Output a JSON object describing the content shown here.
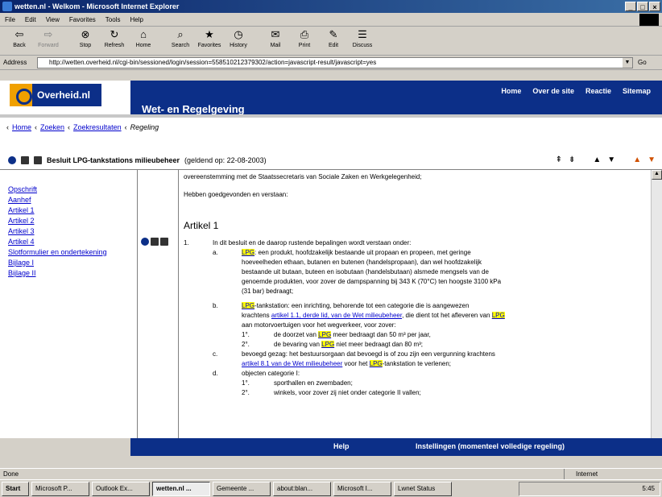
{
  "window": {
    "title": "wetten.nl - Welkom - Microsoft Internet Explorer",
    "buttons": [
      "_",
      "□",
      "×"
    ]
  },
  "menu": [
    "File",
    "Edit",
    "View",
    "Favorites",
    "Tools",
    "Help"
  ],
  "toolbar": [
    {
      "label": "Back",
      "icon": "back-icon",
      "glyph": "⇦",
      "disabled": false
    },
    {
      "label": "Forward",
      "icon": "forward-icon",
      "glyph": "⇨",
      "disabled": true
    },
    {
      "label": "Stop",
      "icon": "stop-icon",
      "glyph": "⊗",
      "disabled": false
    },
    {
      "label": "Refresh",
      "icon": "refresh-icon",
      "glyph": "↻",
      "disabled": false
    },
    {
      "label": "Home",
      "icon": "home-icon",
      "glyph": "⌂",
      "disabled": false
    },
    {
      "label": "Search",
      "icon": "search-icon",
      "glyph": "⌕",
      "disabled": false
    },
    {
      "label": "Favorites",
      "icon": "favorites-icon",
      "glyph": "★",
      "disabled": false
    },
    {
      "label": "History",
      "icon": "history-icon",
      "glyph": "◷",
      "disabled": false
    },
    {
      "label": "Mail",
      "icon": "mail-icon",
      "glyph": "✉",
      "disabled": false
    },
    {
      "label": "Print",
      "icon": "print-icon",
      "glyph": "⎙",
      "disabled": false
    },
    {
      "label": "Edit",
      "icon": "edit-icon",
      "glyph": "✎",
      "disabled": false
    },
    {
      "label": "Discuss",
      "icon": "discuss-icon",
      "glyph": "☰",
      "disabled": false
    }
  ],
  "address": {
    "label": "Address",
    "url": "http://wetten.overheid.nl/cgi-bin/sessioned/login/session=558510212379302/action=javascript-result/javascript=yes",
    "go": "Go"
  },
  "site": {
    "logo_text": "Overheid.nl",
    "section_title": "Wet- en Regelgeving",
    "topnav": [
      "Home",
      "Over de site",
      "Reactie",
      "Sitemap"
    ]
  },
  "breadcrumb": {
    "items": [
      "Home",
      "Zoeken",
      "Zoekresultaten"
    ],
    "current": "Regeling"
  },
  "docbar": {
    "title": "Besluit LPG-tankstations milieubeheer",
    "validity": "(geldend op: 22-08-2003)"
  },
  "leftnav": [
    "Opschrift",
    "Aanhef",
    "Artikel 1",
    "Artikel 2",
    "Artikel 3",
    "Artikel 4",
    "Slotformulier en ondertekening",
    "Bijlage I",
    "Bijlage II"
  ],
  "document": {
    "intro1": "overeenstemming met de Staatssecretaris van Sociale Zaken en Werkgelegenheid;",
    "intro2": "Hebben goedgevonden en verstaan:",
    "article_title": "Artikel 1",
    "para_num": "1.",
    "para_text": "In dit besluit en de daarop rustende bepalingen wordt verstaan onder:",
    "a_label": "a.",
    "a_lpg": "LPG",
    "a_text1": ": een produkt, hoofdzakelijk bestaande uit propaan en propeen, met geringe",
    "a_text2": "hoeveelheden ethaan, butanen en butenen (handelspropaan), dan wel hoofdzakelijk",
    "a_text3": "bestaande uit butaan, buteen en isobutaan (handelsbutaan) alsmede mengsels van de",
    "a_text4": "genoemde produkten, voor zover de dampspanning bij 343 K (70°C) ten hoogste 3100 kPa",
    "a_text5": "(31 bar) bedraagt;",
    "b_label": "b.",
    "b_lpg": "LPG",
    "b_text1": "-tankstation: een inrichting, behorende tot een categorie die is aangewezen",
    "b_text2a": "krachtens ",
    "b_link": "artikel 1.1, derde lid, van de Wet milieubeheer",
    "b_text2b": ", die dient tot het afleveren van ",
    "b_lpg2": "LPG",
    "b_text3": " aan motorvoertuigen voor het wegverkeer, voor zover:",
    "b1_label": "1°.",
    "b1_text1": "de doorzet van ",
    "b1_lpg": "LPG",
    "b1_text2": " meer bedraagt dan 50 m³ per jaar,",
    "b2_label": "2°.",
    "b2_text1": "de bevaring van ",
    "b2_lpg": "LPG",
    "b2_text2": " niet meer bedraagt dan 80 m³;",
    "c_label": "c.",
    "c_text1": "bevoegd gezag: het bestuursorgaan dat bevoegd is of zou zijn een vergunning krachtens",
    "c_link": "artikel 8.1 van de Wet milieubeheer",
    "c_text2": " voor het ",
    "c_lpg": "LPG",
    "c_text3": "-tankstation te verlenen;",
    "d_label": "d.",
    "d_text": "objecten categorie I:",
    "d1_label": "1°.",
    "d1_text": "sporthallen en zwembaden;",
    "d2_label": "2°.",
    "d2_text": "winkels, voor zover zij niet onder categorie II vallen;"
  },
  "footer": {
    "help": "Help",
    "settings": "Instellingen (momenteel volledige regeling)"
  },
  "status": {
    "left": "Done",
    "zone": "Internet"
  },
  "taskbar": {
    "start": "Start",
    "items": [
      "Microsoft P...",
      "Outlook Ex...",
      "wetten.nl ...",
      "Gemeente ...",
      "about:blan...",
      "Microsoft I...",
      "Lwnet Status"
    ],
    "active_index": 2,
    "clock": "5:45"
  }
}
